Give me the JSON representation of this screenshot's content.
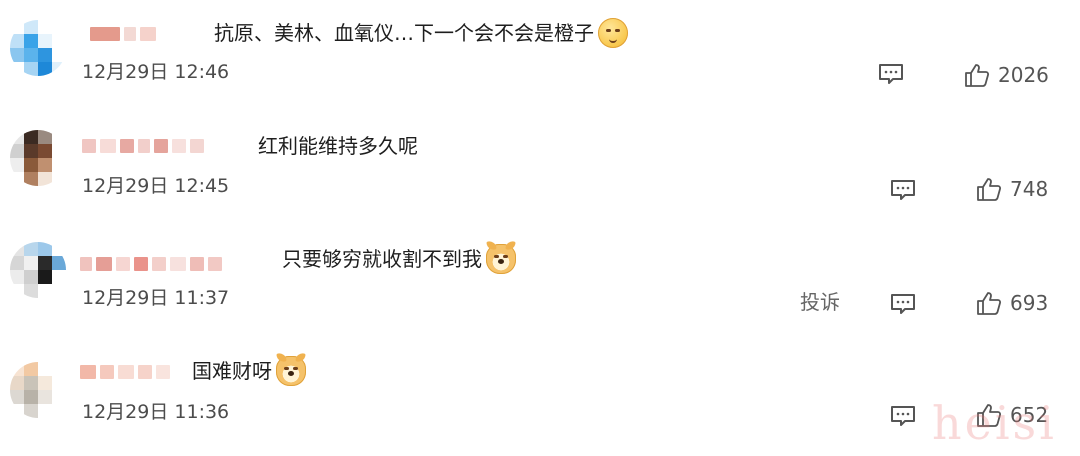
{
  "comments": [
    {
      "text": "抗原、美林、血氧仪…下一个会不会是橙子",
      "emoji": "shushing-face-emoji",
      "timestamp": "12月29日 12:46",
      "like_count": "2026",
      "report_label": ""
    },
    {
      "text": "红利能维持多久呢",
      "emoji": "",
      "timestamp": "12月29日 12:45",
      "like_count": "748",
      "report_label": ""
    },
    {
      "text": "只要够穷就收割不到我",
      "emoji": "doge-emoji",
      "timestamp": "12月29日 11:37",
      "like_count": "693",
      "report_label": "投诉"
    },
    {
      "text": "国难财呀",
      "emoji": "doge-emoji",
      "timestamp": "12月29日 11:36",
      "like_count": "652",
      "report_label": ""
    }
  ],
  "icons": {
    "reply": "comment-bubble-icon",
    "like": "thumbs-up-icon"
  },
  "colors": {
    "icon_stroke": "#555555",
    "text": "#1e1e1e",
    "meta_text": "#4c4c4c"
  }
}
